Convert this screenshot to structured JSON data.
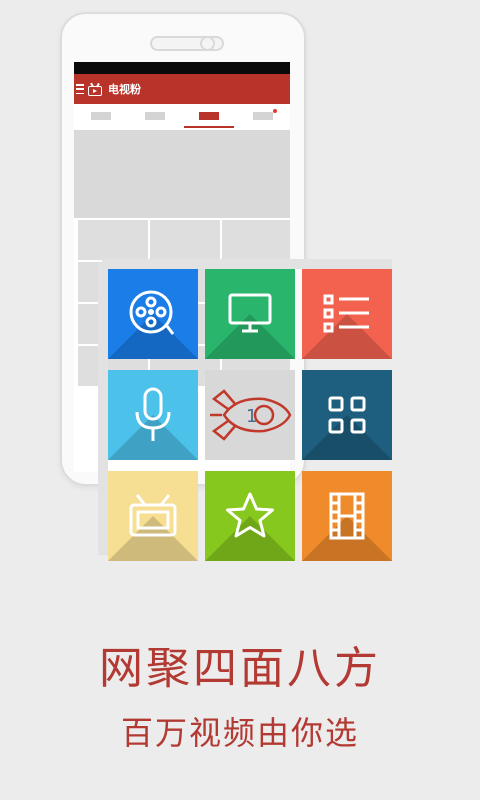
{
  "app": {
    "title": "电视粉"
  },
  "tiles": [
    {
      "name": "video-reel-tile",
      "icon": "film-reel-icon",
      "color": "#1a7de8"
    },
    {
      "name": "monitor-tile",
      "icon": "monitor-icon",
      "color": "#29b56c"
    },
    {
      "name": "list-tile",
      "icon": "list-icon",
      "color": "#f2624f"
    },
    {
      "name": "voice-tile",
      "icon": "microphone-icon",
      "color": "#4cc1ea"
    },
    {
      "name": "rocket-tile",
      "icon": "rocket-icon",
      "color": "#d8d8d8",
      "label": "1"
    },
    {
      "name": "apps-tile",
      "icon": "grid-icon",
      "color": "#1e5e7e"
    },
    {
      "name": "tv-tile",
      "icon": "tv-icon",
      "color": "#f6de93"
    },
    {
      "name": "favorite-tile",
      "icon": "star-icon",
      "color": "#86c81d"
    },
    {
      "name": "movie-tile",
      "icon": "film-strip-icon",
      "color": "#f08b2c"
    }
  ],
  "headline": "网聚四面八方",
  "subline": "百万视频由你选",
  "colors": {
    "brand": "#b8342a",
    "text_accent": "#b23a33"
  }
}
